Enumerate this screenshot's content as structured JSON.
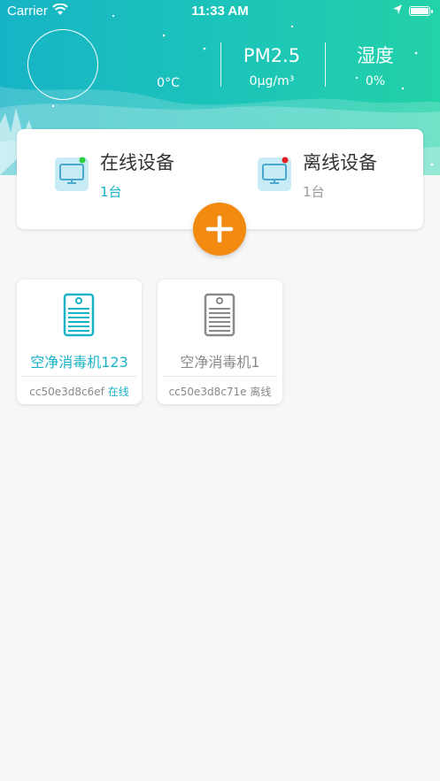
{
  "status_bar": {
    "carrier": "Carrier",
    "time": "11:33 AM"
  },
  "weather": {
    "temperature": "0°C",
    "pm25_label": "PM2.5",
    "pm25_value": "0μg/m³",
    "humidity_label": "湿度",
    "humidity_value": "0%"
  },
  "summary": {
    "online": {
      "title": "在线设备",
      "count": "1台",
      "indicator_color": "#2ecc40"
    },
    "offline": {
      "title": "离线设备",
      "count": "1台",
      "indicator_color": "#e02020"
    }
  },
  "add_button": {
    "icon": "plus-icon",
    "color": "#f28a0f"
  },
  "devices": [
    {
      "name": "空净消毒机123",
      "id": "cc50e3d8c6ef",
      "status": "在线",
      "color": "#18b3c7",
      "icon": "air-purifier-icon"
    },
    {
      "name": "空净消毒机1",
      "id": "cc50e3d8c71e",
      "status": "离线",
      "color": "#8a8a8a",
      "icon": "air-purifier-icon"
    }
  ],
  "theme": {
    "accent": "#18b3c7",
    "header_gradient": [
      "#17b4c6",
      "#22d2a8"
    ]
  }
}
